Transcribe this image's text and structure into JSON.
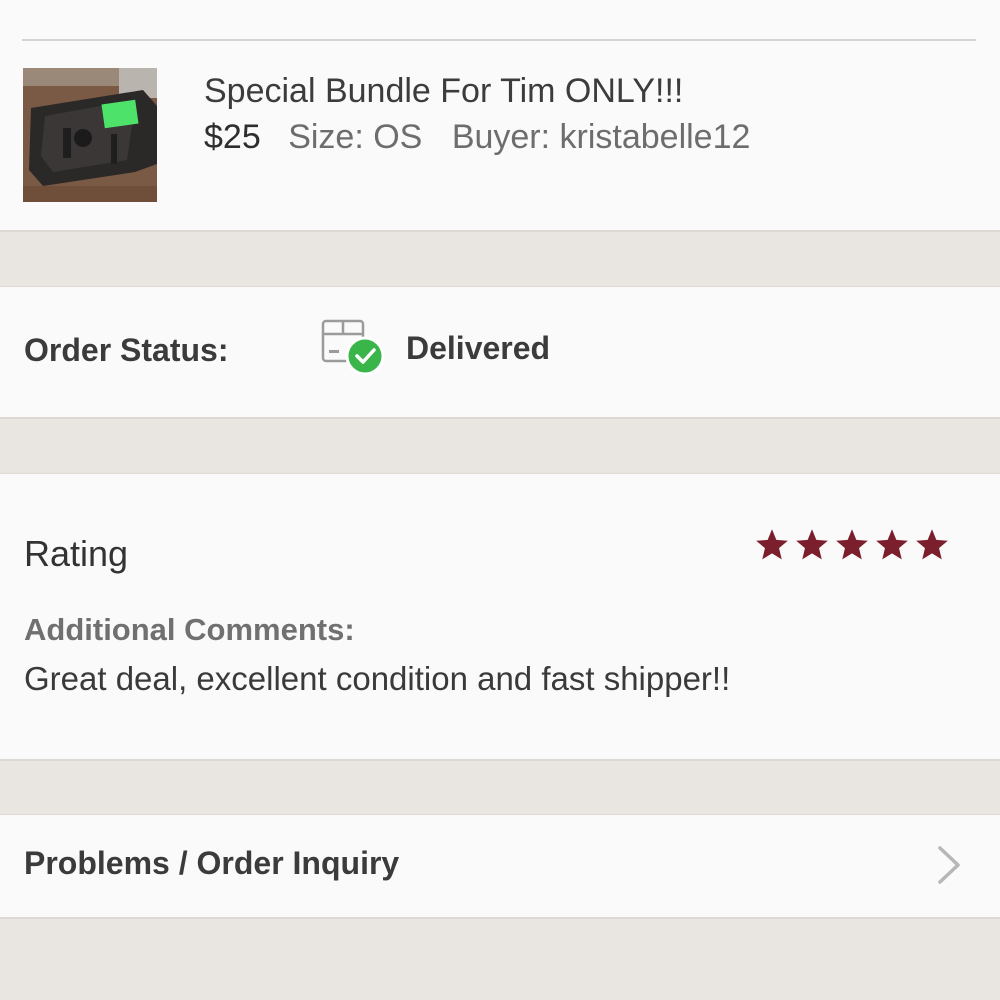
{
  "listing": {
    "title": "Special Bundle For Tim ONLY!!!",
    "price": "$25",
    "size": "Size: OS",
    "buyer": "Buyer: kristabelle12"
  },
  "order_status": {
    "label": "Order Status:",
    "value": "Delivered",
    "icon": "package-delivered-icon"
  },
  "rating": {
    "label": "Rating",
    "stars": 5,
    "max_stars": 5,
    "star_color": "#7b1f2c",
    "comments_label": "Additional Comments:",
    "comments": "Great deal, excellent condition and fast shipper!!"
  },
  "inquiry": {
    "label": "Problems / Order Inquiry",
    "icon": "chevron-right-icon"
  },
  "colors": {
    "accent_check": "#3ab54a"
  }
}
